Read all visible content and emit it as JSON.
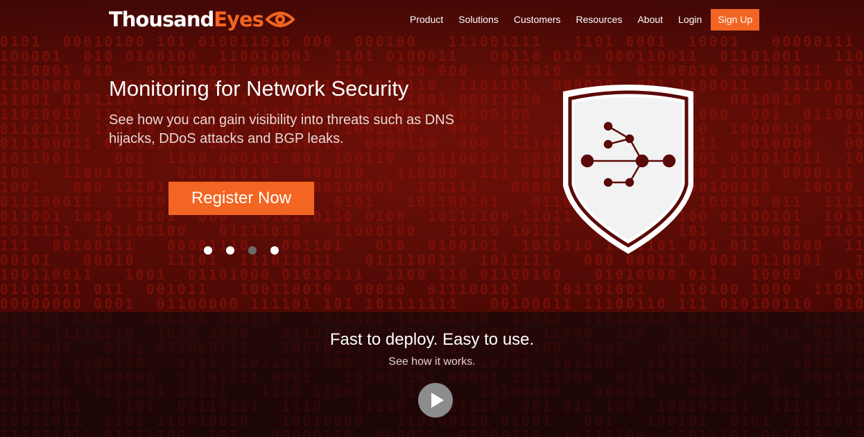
{
  "brand": {
    "name_part1": "Thousand",
    "name_part2": "Eyes",
    "accent_color": "#f26522",
    "logo_icon": "eye-icon"
  },
  "nav": {
    "items": [
      {
        "label": "Product"
      },
      {
        "label": "Solutions"
      },
      {
        "label": "Customers"
      },
      {
        "label": "Resources"
      },
      {
        "label": "About"
      },
      {
        "label": "Login"
      }
    ],
    "signup_label": "Sign Up"
  },
  "hero": {
    "headline": "Monitoring for Network Security",
    "subline": "See how you can gain visibility into threats such as DNS hijacks, DDoS attacks and BGP leaks.",
    "cta_label": "Register Now",
    "carousel": {
      "count": 4,
      "active_index": 3
    },
    "illustration_icon": "shield-network-icon",
    "background_colors": {
      "hero": "#6a0f08",
      "lower": "#1c0606"
    }
  },
  "video": {
    "title": "Fast to deploy. Easy to use.",
    "subtitle": "See how it works.",
    "play_icon": "play-icon"
  }
}
